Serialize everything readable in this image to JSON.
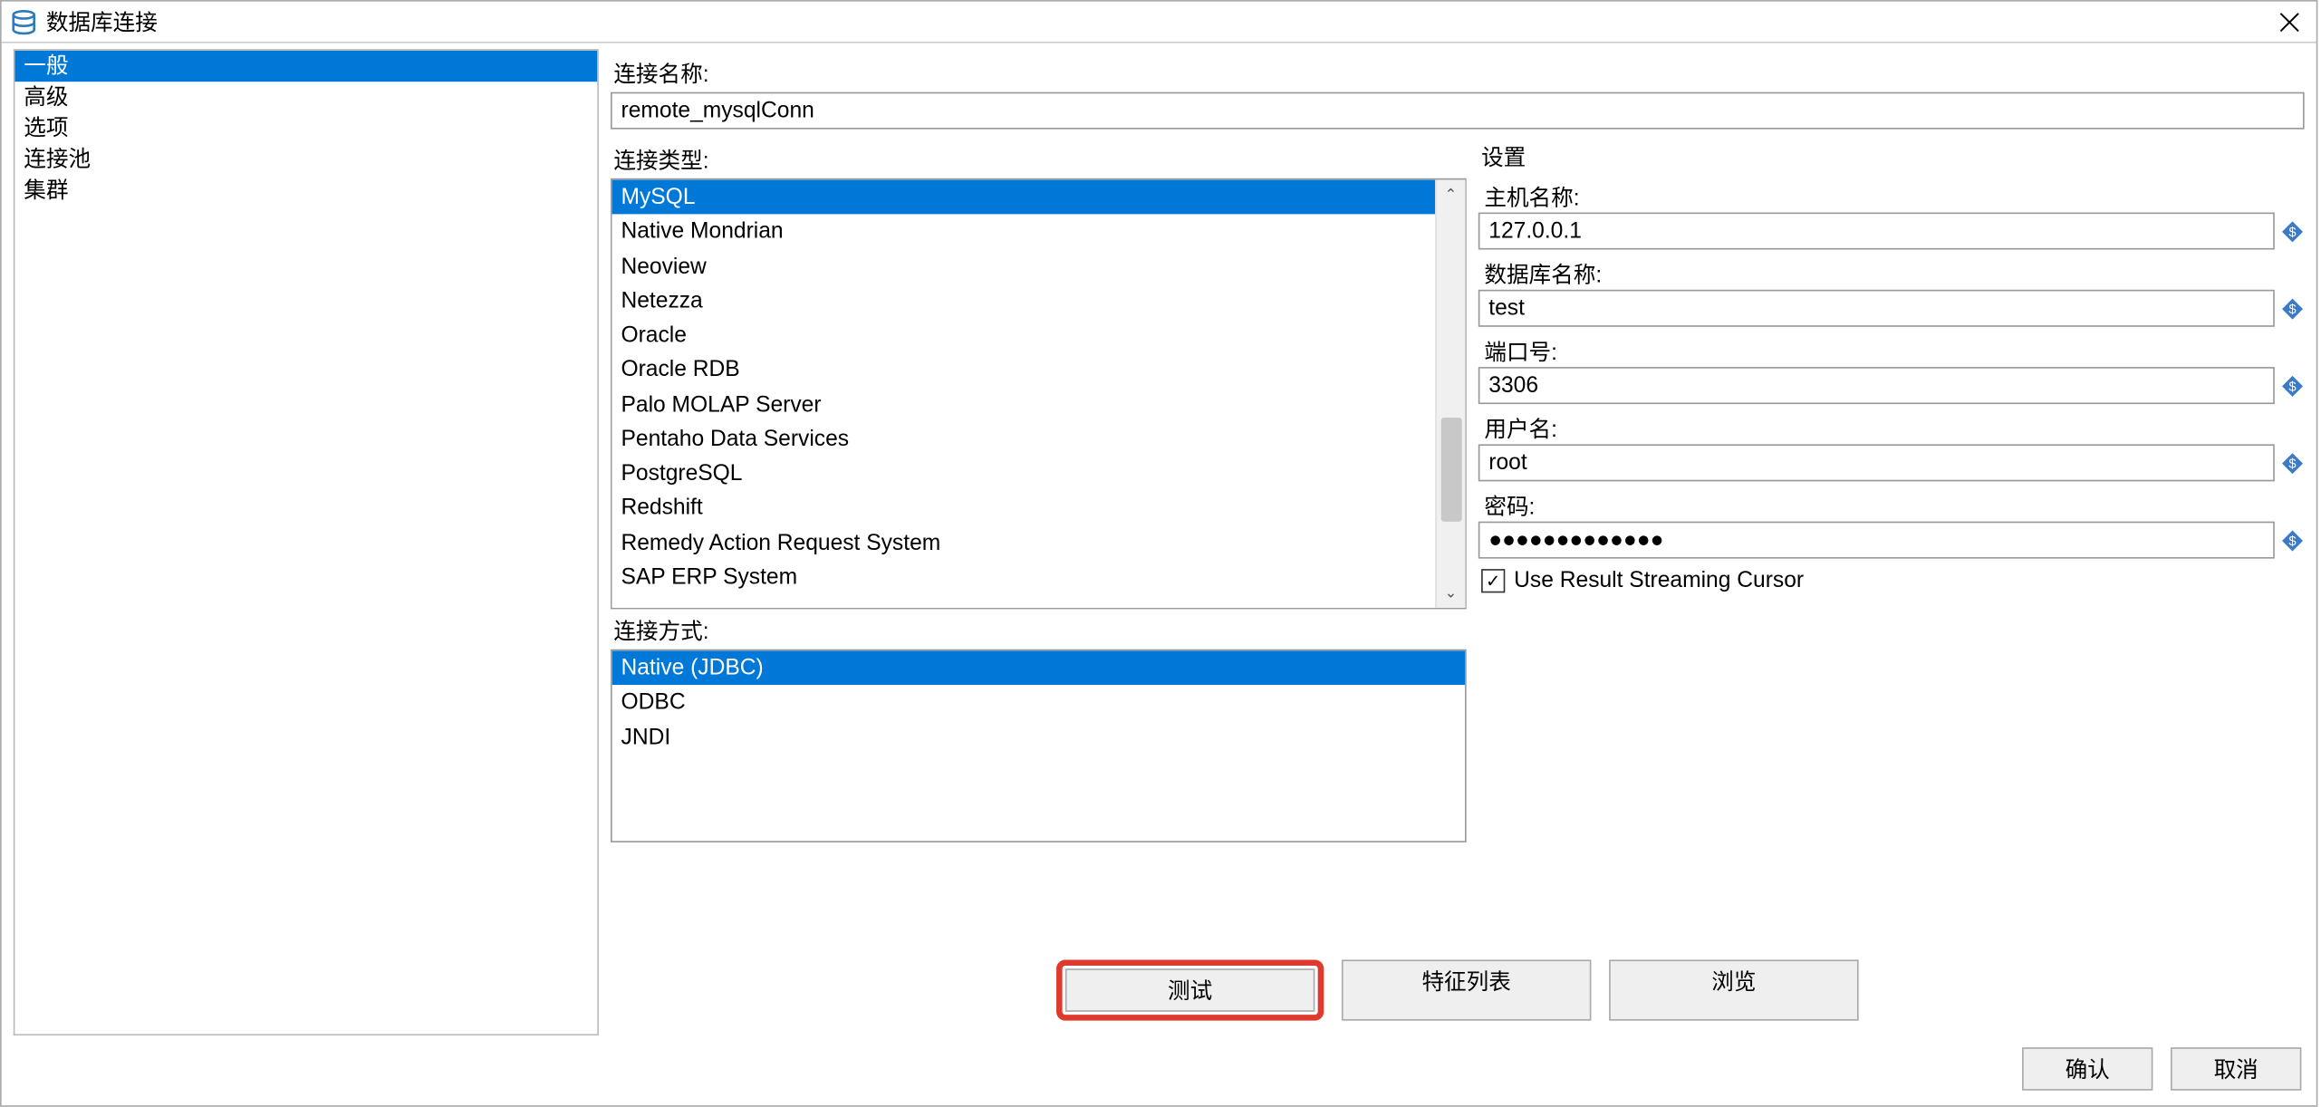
{
  "window": {
    "title": "数据库连接"
  },
  "sidebar": {
    "items": [
      {
        "label": "一般",
        "selected": true
      },
      {
        "label": "高级",
        "selected": false
      },
      {
        "label": "选项",
        "selected": false
      },
      {
        "label": "连接池",
        "selected": false
      },
      {
        "label": "集群",
        "selected": false
      }
    ]
  },
  "form": {
    "connection_name_label": "连接名称:",
    "connection_name_value": "remote_mysqlConn",
    "connection_type_label": "连接类型:",
    "connection_method_label": "连接方式:"
  },
  "connection_types": [
    {
      "label": "MySQL",
      "selected": true
    },
    {
      "label": "Native Mondrian"
    },
    {
      "label": "Neoview"
    },
    {
      "label": "Netezza"
    },
    {
      "label": "Oracle"
    },
    {
      "label": "Oracle RDB"
    },
    {
      "label": "Palo MOLAP Server"
    },
    {
      "label": "Pentaho Data Services"
    },
    {
      "label": "PostgreSQL"
    },
    {
      "label": "Redshift"
    },
    {
      "label": "Remedy Action Request System"
    },
    {
      "label": "SAP ERP System"
    }
  ],
  "connection_methods": [
    {
      "label": "Native (JDBC)",
      "selected": true
    },
    {
      "label": "ODBC"
    },
    {
      "label": "JNDI"
    }
  ],
  "settings": {
    "group_label": "设置",
    "host_label": "主机名称:",
    "host_value": "127.0.0.1",
    "db_label": "数据库名称:",
    "db_value": "test",
    "port_label": "端口号:",
    "port_value": "3306",
    "user_label": "用户名:",
    "user_value": "root",
    "password_label": "密码:",
    "password_value": "●●●●●●●●●●●●●",
    "checkbox_label": "Use Result Streaming Cursor",
    "checkbox_checked": true
  },
  "buttons": {
    "test": "测试",
    "feature_list": "特征列表",
    "browse": "浏览",
    "ok": "确认",
    "cancel": "取消"
  }
}
